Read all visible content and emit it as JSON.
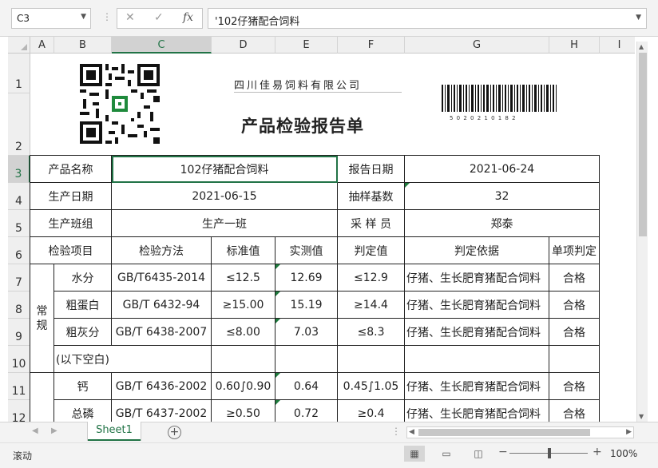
{
  "formula_bar": {
    "name_box": "C3",
    "cancel_icon": "✕",
    "enter_icon": "✓",
    "fx_label": "fx",
    "formula": "'102仔猪配合饲料"
  },
  "columns": [
    "A",
    "B",
    "C",
    "D",
    "E",
    "F",
    "G",
    "H",
    "I"
  ],
  "rows": [
    "1",
    "2",
    "3",
    "4",
    "5",
    "6",
    "7",
    "8",
    "9",
    "10",
    "11",
    "12"
  ],
  "header": {
    "company": "四川佳易饲料有限公司",
    "title": "产品检验报告单",
    "barcode_digits": "5 0 2 0 2 1 0 1 8 2"
  },
  "info": {
    "product_name_label": "产品名称",
    "product_name": "102仔猪配合饲料",
    "report_date_label": "报告日期",
    "report_date": "2021-06-24",
    "prod_date_label": "生产日期",
    "prod_date": "2021-06-15",
    "sample_base_label": "抽样基数",
    "sample_base": "32",
    "team_label": "生产班组",
    "team": "生产一班",
    "sampler_label": "采 样 员",
    "sampler": "郑泰"
  },
  "table": {
    "headers": [
      "检验项目",
      "检验方法",
      "标准值",
      "实测值",
      "判定值",
      "判定依据",
      "单项判定"
    ],
    "group_label": "常规",
    "rows": [
      [
        "水分",
        "GB/T6435-2014",
        "≤12.5",
        "12.69",
        "≤12.9",
        "仔猪、生长肥育猪配合饲料",
        "合格"
      ],
      [
        "粗蛋白",
        "GB/T 6432-94",
        "≥15.00",
        "15.19",
        "≥14.4",
        "仔猪、生长肥育猪配合饲料",
        "合格"
      ],
      [
        "粗灰分",
        "GB/T 6438-2007",
        "≤8.00",
        "7.03",
        "≤8.3",
        "仔猪、生长肥育猪配合饲料",
        "合格"
      ]
    ],
    "blank_note": "(以下空白)",
    "rows2": [
      [
        "钙",
        "GB/T 6436-2002",
        "0.60∫0.90",
        "0.64",
        "0.45∫1.05",
        "仔猪、生长肥育猪配合饲料",
        "合格"
      ],
      [
        "总磷",
        "GB/T 6437-2002",
        "≥0.50",
        "0.72",
        "≥0.4",
        "仔猪、生长肥育猪配合饲料",
        "合格"
      ]
    ]
  },
  "sheet_tab": "Sheet1",
  "status": {
    "mode": "滚动",
    "zoom": "100%"
  },
  "colors": {
    "accent": "#217346"
  }
}
